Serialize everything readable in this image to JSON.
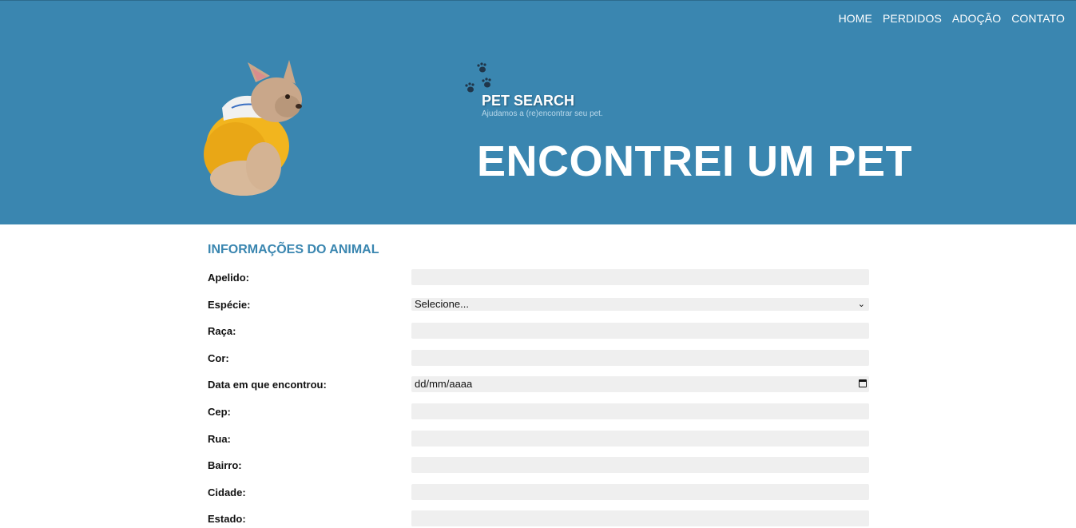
{
  "nav": {
    "items": [
      {
        "label": "HOME"
      },
      {
        "label": "PERDIDOS"
      },
      {
        "label": "ADOÇÃO"
      },
      {
        "label": "CONTATO"
      }
    ]
  },
  "brand": {
    "name": "PET SEARCH",
    "tagline": "Ajudamos a (re)encontrar seu pet."
  },
  "hero": {
    "title": "ENCONTREI UM PET"
  },
  "form": {
    "section_title": "INFORMAÇÕES DO ANIMAL",
    "fields": [
      {
        "label": "Apelido:",
        "type": "text",
        "value": ""
      },
      {
        "label": "Espécie:",
        "type": "select",
        "value": "Selecione..."
      },
      {
        "label": "Raça:",
        "type": "text",
        "value": ""
      },
      {
        "label": "Cor:",
        "type": "text",
        "value": ""
      },
      {
        "label": "Data em que encontrou:",
        "type": "date",
        "value": "dd/mm/aaaa"
      },
      {
        "label": "Cep:",
        "type": "text",
        "value": ""
      },
      {
        "label": "Rua:",
        "type": "text",
        "value": ""
      },
      {
        "label": "Bairro:",
        "type": "text",
        "value": ""
      },
      {
        "label": "Cidade:",
        "type": "text",
        "value": ""
      },
      {
        "label": "Estado:",
        "type": "text",
        "value": ""
      }
    ]
  },
  "colors": {
    "header_bg": "#3a86b0",
    "accent": "#3a86b0",
    "field_bg": "#efefef"
  }
}
